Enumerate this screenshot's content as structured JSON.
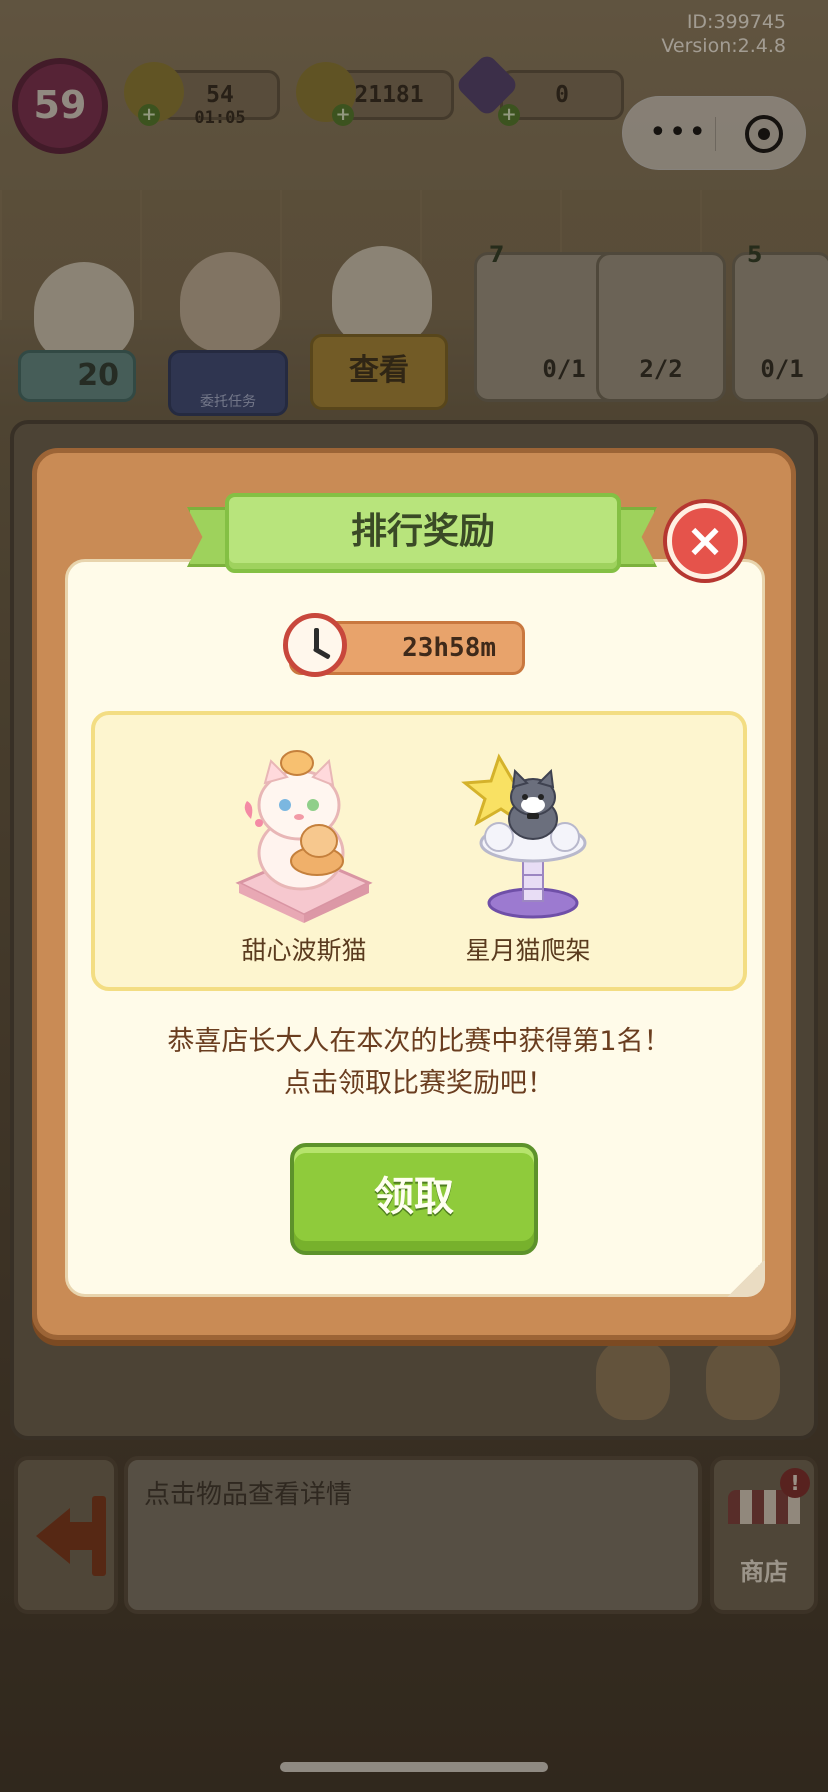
{
  "meta": {
    "id_text": "ID:399745",
    "version_text": "Version:2.4.8"
  },
  "hud": {
    "level": "59",
    "energy": "54",
    "energy_timer": "01:05",
    "coins": "21181",
    "gems": "0"
  },
  "staff": {
    "star_count": "20",
    "commission_label": "委托任务",
    "view_label": "查看"
  },
  "cards": [
    {
      "star": "7",
      "count": "0/1"
    },
    {
      "star": "",
      "count": "2/2"
    },
    {
      "star": "5",
      "count": "0/1"
    }
  ],
  "modal": {
    "title": "排行奖励",
    "close_icon": "×",
    "timer": "23h58m",
    "rewards": [
      {
        "name": "甜心波斯猫"
      },
      {
        "name": "星月猫爬架"
      }
    ],
    "message_line1": "恭喜店长大人在本次的比赛中获得第1名！",
    "message_line2": "点击领取比赛奖励吧！",
    "claim_label": "领取"
  },
  "bottom": {
    "detail_placeholder": "点击物品查看详情",
    "shop_label": "商店",
    "shop_notice": "!"
  },
  "colors": {
    "modal_frame": "#c98b55",
    "ribbon_green": "#b8e47c",
    "claim_green": "#8fcb3b",
    "close_red": "#e5534b",
    "timer_orange": "#e8a36b"
  }
}
